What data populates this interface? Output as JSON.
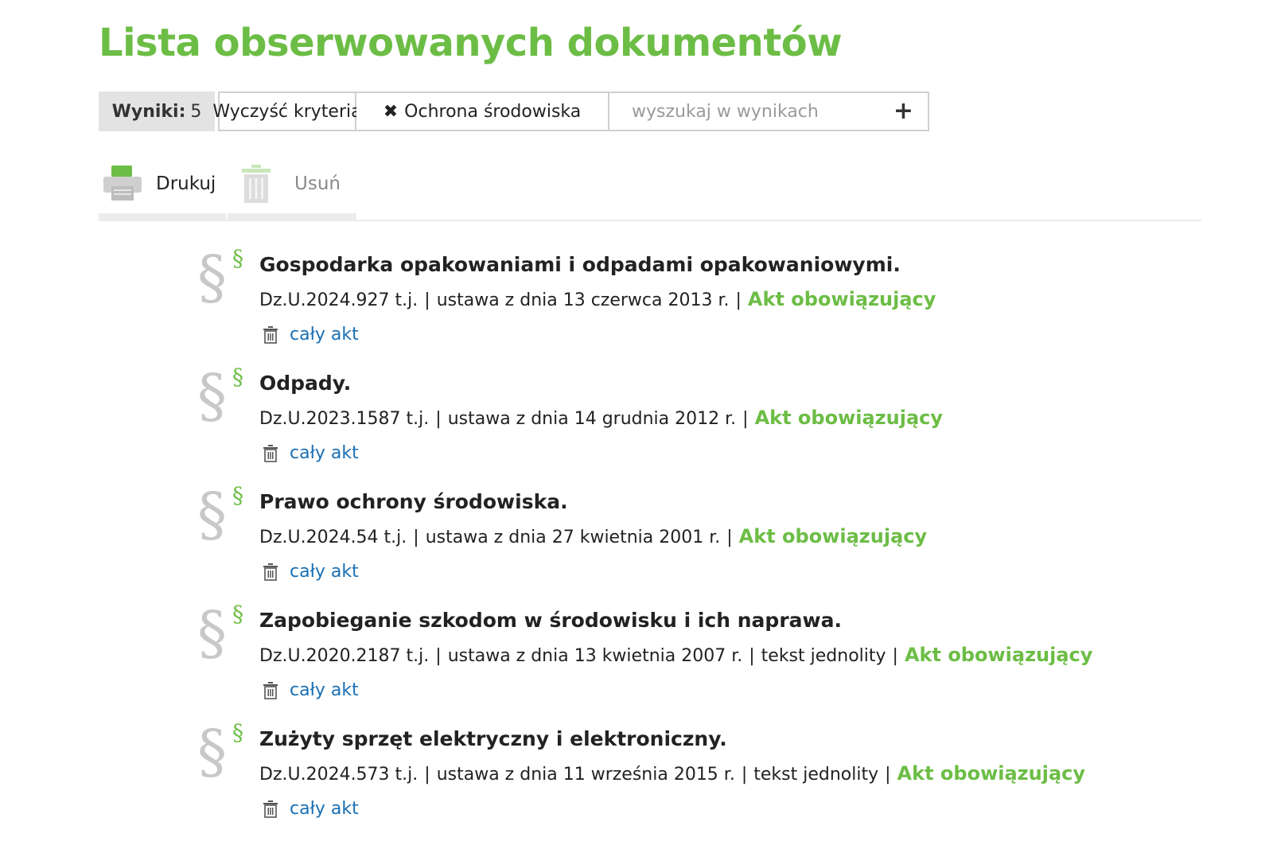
{
  "page_title": "Lista obserwowanych dokumentów",
  "filter_bar": {
    "results_label": "Wyniki:",
    "results_count": "5",
    "clear_label": "Wyczyść kryteria",
    "tag_label": "Ochrona środowiska",
    "search_placeholder": "wyszukaj w wynikach",
    "search_value": ""
  },
  "toolbar": {
    "print_label": "Drukuj",
    "delete_label": "Usuń"
  },
  "colors": {
    "accent": "#6cbd45",
    "link": "#1a6fb3",
    "icon_gray": "#c8c8c8"
  },
  "icons": [
    "close-icon",
    "plus-icon",
    "printer-icon",
    "trash-icon",
    "paragraph-icon"
  ],
  "documents": [
    {
      "title": "Gospodarka opakowaniami i odpadami opakowaniowymi.",
      "reference": "Dz.U.2024.927 t.j.",
      "act": "ustawa z dnia 13 czerwca 2013 r.",
      "extra": "",
      "status": "Akt obowiązujący",
      "link": "cały akt"
    },
    {
      "title": "Odpady.",
      "reference": "Dz.U.2023.1587 t.j.",
      "act": "ustawa z dnia 14 grudnia 2012 r.",
      "extra": "",
      "status": "Akt obowiązujący",
      "link": "cały akt"
    },
    {
      "title": "Prawo ochrony środowiska.",
      "reference": "Dz.U.2024.54 t.j.",
      "act": "ustawa z dnia 27 kwietnia 2001 r.",
      "extra": "",
      "status": "Akt obowiązujący",
      "link": "cały akt"
    },
    {
      "title": "Zapobieganie szkodom w środowisku i ich naprawa.",
      "reference": "Dz.U.2020.2187 t.j.",
      "act": "ustawa z dnia 13 kwietnia 2007 r.",
      "extra": "tekst jednolity",
      "status": "Akt obowiązujący",
      "link": "cały akt"
    },
    {
      "title": "Zużyty sprzęt elektryczny i elektroniczny.",
      "reference": "Dz.U.2024.573 t.j.",
      "act": "ustawa z dnia 11 września 2015 r.",
      "extra": "tekst jednolity",
      "status": "Akt obowiązujący",
      "link": "cały akt"
    }
  ]
}
